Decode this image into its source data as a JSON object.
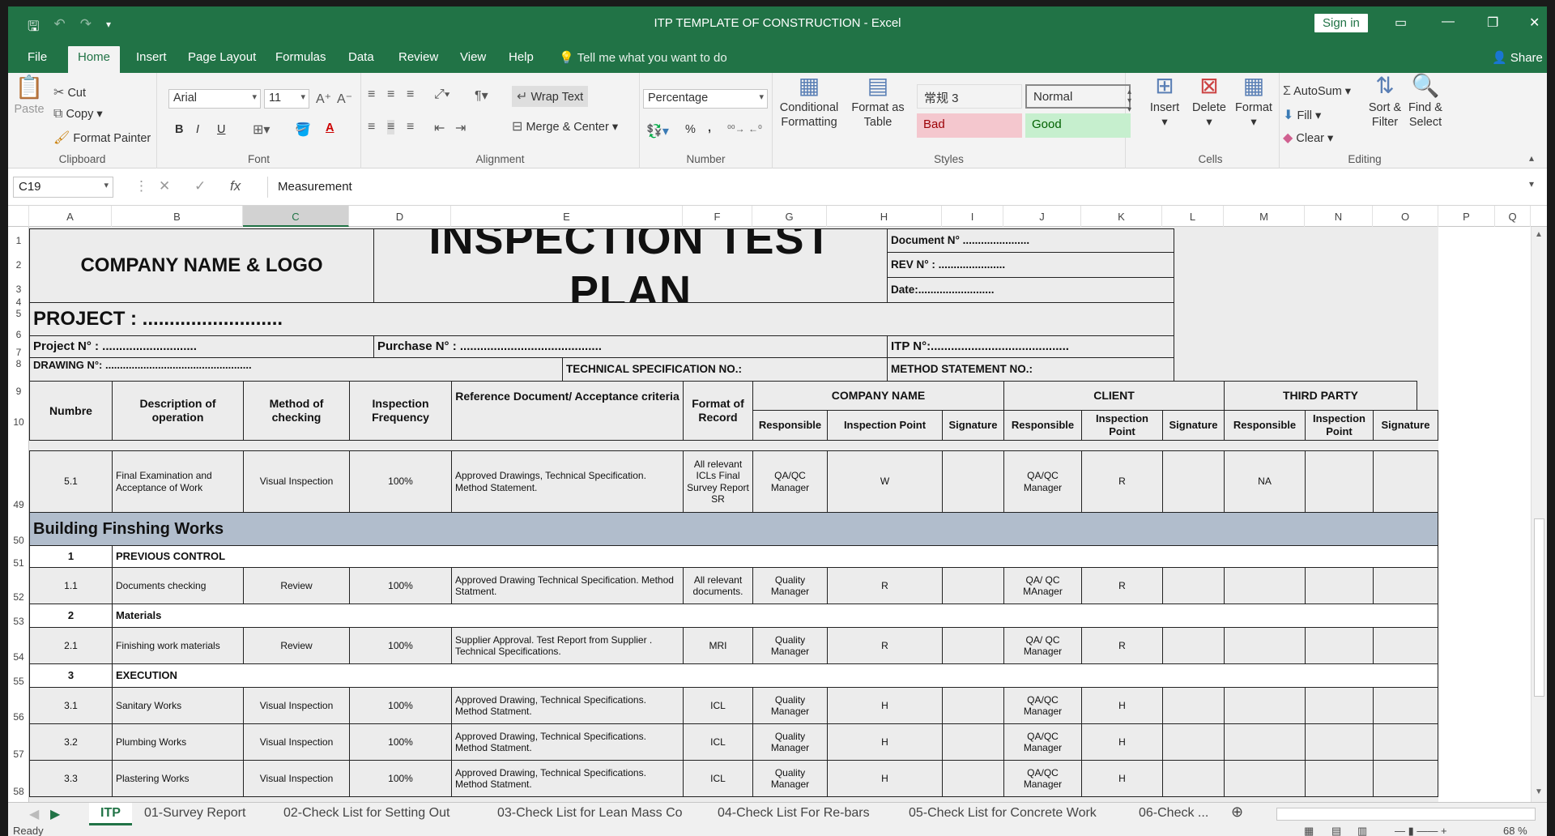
{
  "window": {
    "title": "ITP TEMPLATE OF CONSTRUCTION  -  Excel",
    "sign_in": "Sign in",
    "share": "Share"
  },
  "ribbon_tabs": [
    "File",
    "Home",
    "Insert",
    "Page Layout",
    "Formulas",
    "Data",
    "Review",
    "View",
    "Help"
  ],
  "tell_me": "Tell me what you want to do",
  "clipboard": {
    "paste": "Paste",
    "cut": "Cut",
    "copy": "Copy",
    "format_painter": "Format Painter",
    "label": "Clipboard"
  },
  "font": {
    "name": "Arial",
    "size": "11",
    "bold": "B",
    "italic": "I",
    "underline": "U",
    "label": "Font"
  },
  "alignment": {
    "wrap_text": "Wrap Text",
    "merge_center": "Merge & Center",
    "label": "Alignment"
  },
  "number": {
    "format": "Percentage",
    "percent": "%",
    "comma": ",",
    "label": "Number"
  },
  "styles": {
    "conditional_formatting": "Conditional Formatting",
    "format_as_table": "Format as Table",
    "cells": [
      {
        "name": "常规 3",
        "bg": "#ffffff",
        "fg": "#222222"
      },
      {
        "name": "Normal",
        "bg": "#ffffff",
        "fg": "#222222"
      },
      {
        "name": "Bad",
        "bg": "#f4c7ce",
        "fg": "#9c0006"
      },
      {
        "name": "Good",
        "bg": "#c6efce",
        "fg": "#006100"
      }
    ],
    "label": "Styles"
  },
  "cells_group": {
    "insert": "Insert",
    "delete": "Delete",
    "format": "Format",
    "label": "Cells"
  },
  "editing": {
    "autosum": "AutoSum",
    "fill": "Fill",
    "clear": "Clear",
    "sort_filter": "Sort & Filter",
    "find_select": "Find & Select",
    "label": "Editing"
  },
  "formula_bar": {
    "name_box": "C19",
    "value": "Measurement"
  },
  "columns": [
    "A",
    "B",
    "C",
    "D",
    "E",
    "F",
    "G",
    "H",
    "I",
    "J",
    "K",
    "L",
    "M",
    "N",
    "O",
    "P",
    "Q"
  ],
  "rows": [
    "1",
    "2",
    "3",
    "4",
    "5",
    "6",
    "7",
    "8",
    "9",
    "10",
    "49",
    "50",
    "51",
    "52",
    "53",
    "54",
    "55",
    "56",
    "57",
    "58"
  ],
  "sheet": {
    "company": "COMPANY NAME & LOGO",
    "title": "INSPECTION TEST PLAN",
    "document_no": "Document N° ......................",
    "rev_no": "REV N° :    ......................",
    "date": "Date:.........................",
    "project": "PROJECT :  ..........................",
    "project_no": "Project N° : ............................",
    "purchase_no": "Purchase N° : ..........................................",
    "itp_no": "ITP N°:.........................................",
    "drawing_no": "DRAWING N°: ..................................................",
    "tech_spec": "TECHNICAL SPECIFICATION NO.:",
    "method_statement": "METHOD STATEMENT NO.:",
    "headers": {
      "numbre": "Numbre",
      "description": "Description of operation",
      "method": "Method of checking",
      "frequency": "Inspection Frequency",
      "reference": "Reference Document/ Acceptance criteria",
      "format": "Format of Record",
      "company_name": "COMPANY NAME",
      "client": "CLIENT",
      "third_party": "THIRD PARTY",
      "responsible": "Responsible",
      "inspection_point": "Inspection Point",
      "signature": "Signature"
    },
    "section_title": "Building Finshing Works",
    "groups": [
      {
        "no": "1",
        "name": "PREVIOUS CONTROL"
      },
      {
        "no": "2",
        "name": "Materials"
      },
      {
        "no": "3",
        "name": "EXECUTION"
      }
    ],
    "items": [
      {
        "no": "5.1",
        "desc": "Final Examination and Acceptance of Work",
        "method": "Visual Inspection",
        "freq": "100%",
        "ref": "Approved Drawings, Technical Specification. Method Statement.",
        "format": "All relevant ICLs  Final Survey Report SR",
        "c_resp": "QA/QC Manager",
        "c_point": "W",
        "cl_resp": "QA/QC Manager",
        "cl_point": "R",
        "tp_resp": "NA"
      },
      {
        "no": "1.1",
        "desc": "Documents checking",
        "method": "Review",
        "freq": "100%",
        "ref": "Approved Drawing Technical Specification. Method Statment.",
        "format": "All relevant documents.",
        "c_resp": "Quality Manager",
        "c_point": "R",
        "cl_resp": "QA/ QC MAnager",
        "cl_point": "R",
        "tp_resp": ""
      },
      {
        "no": "2.1",
        "desc": "Finishing work materials",
        "method": "Review",
        "freq": "100%",
        "ref": "Supplier Approval. Test Report from Supplier . Technical Specifications.",
        "format": "MRI",
        "c_resp": "Quality Manager",
        "c_point": "R",
        "cl_resp": "QA/ QC Manager",
        "cl_point": "R",
        "tp_resp": ""
      },
      {
        "no": "3.1",
        "desc": "Sanitary Works",
        "method": "Visual Inspection",
        "freq": "100%",
        "ref": "Approved Drawing, Technical Specifications. Method Statment.",
        "format": "ICL",
        "c_resp": "Quality Manager",
        "c_point": "H",
        "cl_resp": "QA/QC Manager",
        "cl_point": "H",
        "tp_resp": ""
      },
      {
        "no": "3.2",
        "desc": "Plumbing Works",
        "method": "Visual Inspection",
        "freq": "100%",
        "ref": "Approved Drawing, Technical Specifications. Method Statment.",
        "format": "ICL",
        "c_resp": "Quality Manager",
        "c_point": "H",
        "cl_resp": "QA/QC Manager",
        "cl_point": "H",
        "tp_resp": ""
      },
      {
        "no": "3.3",
        "desc": "Plastering Works",
        "method": "Visual Inspection",
        "freq": "100%",
        "ref": "Approved Drawing, Technical Specifications. Method Statment.",
        "format": "ICL",
        "c_resp": "Quality Manager",
        "c_point": "H",
        "cl_resp": "QA/QC Manager",
        "cl_point": "H",
        "tp_resp": ""
      }
    ]
  },
  "sheet_tabs": [
    "ITP",
    "01-Survey Report",
    "02-Check List for Setting Out",
    "03-Check List for Lean Mass Co",
    "04-Check List For Re-bars",
    "05-Check List for Concrete Work",
    "06-Check ..."
  ],
  "status": {
    "text": "Ready",
    "zoom": "68 %"
  },
  "colors": {
    "excel_green": "#217346",
    "section_fill": "#b1bdcc"
  }
}
